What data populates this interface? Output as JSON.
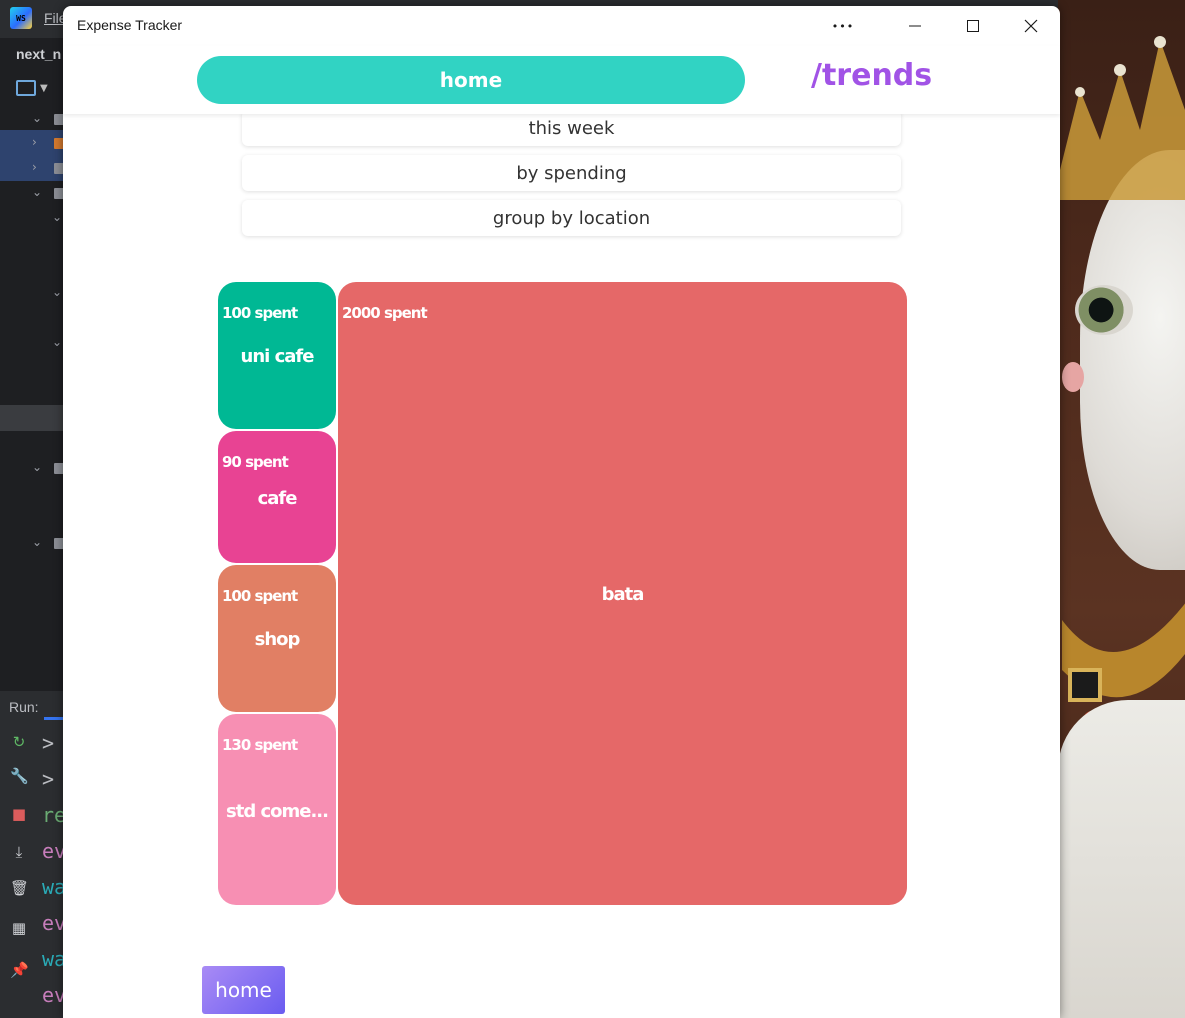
{
  "ide": {
    "menu_file": "File",
    "project_name": "next_n",
    "run_label": "Run:",
    "console_lines": [
      {
        "text": ">",
        "color": "#bbbdc2"
      },
      {
        "text": ">",
        "color": "#bbbdc2"
      },
      {
        "text": "re",
        "color": "#6aab73"
      },
      {
        "text": "ev",
        "color": "#c77dbb"
      },
      {
        "text": "wa",
        "color": "#2aacb8"
      },
      {
        "text": "ev",
        "color": "#c77dbb"
      },
      {
        "text": "wa",
        "color": "#2aacb8"
      },
      {
        "text": "ev",
        "color": "#c77dbb"
      }
    ]
  },
  "window": {
    "title": "Expense Tracker",
    "more_label": "•••"
  },
  "nav": {
    "home_label": "home",
    "trends_label": "/trends"
  },
  "filters": [
    "this week",
    "by spending",
    "group by location"
  ],
  "treemap": {
    "tiles": [
      {
        "location": "uni cafe",
        "amount_label": "100 spent",
        "value": 100,
        "color": "#00b894"
      },
      {
        "location": "cafe",
        "amount_label": "90 spent",
        "value": 90,
        "color": "#e84393"
      },
      {
        "location": "shop",
        "amount_label": "100 spent",
        "value": 100,
        "color": "#e17f64"
      },
      {
        "location": "std come...",
        "amount_label": "130 spent",
        "value": 130,
        "color": "#f78fb3"
      },
      {
        "location": "bata",
        "amount_label": "2000 spent",
        "value": 2000,
        "color": "#e56868"
      }
    ]
  },
  "footer": {
    "home_button": "home"
  }
}
